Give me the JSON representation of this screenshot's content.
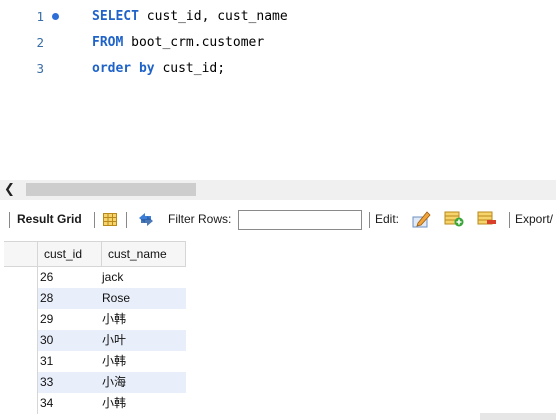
{
  "editor": {
    "lines": [
      {
        "number": "1",
        "executable": true,
        "keyword": "SELECT",
        "rest": " cust_id, cust_name"
      },
      {
        "number": "2",
        "executable": false,
        "keyword": "FROM",
        "rest": " boot_crm.customer"
      },
      {
        "number": "3",
        "executable": false,
        "keyword": "order by",
        "rest": " cust_id;"
      }
    ]
  },
  "toolbar": {
    "result_grid_label": "Result Grid",
    "filter_rows_label": "Filter Rows:",
    "filter_rows_value": "",
    "edit_label": "Edit:",
    "export_label": "Export/"
  },
  "grid": {
    "columns": [
      "cust_id",
      "cust_name"
    ],
    "rows": [
      {
        "cust_id": "26",
        "cust_name": "jack"
      },
      {
        "cust_id": "28",
        "cust_name": "Rose"
      },
      {
        "cust_id": "29",
        "cust_name": "小韩"
      },
      {
        "cust_id": "30",
        "cust_name": "小叶"
      },
      {
        "cust_id": "31",
        "cust_name": "小韩"
      },
      {
        "cust_id": "33",
        "cust_name": "小海"
      },
      {
        "cust_id": "34",
        "cust_name": "小韩"
      }
    ]
  },
  "icons": {
    "grid": "grid-view-icon",
    "refresh": "refresh-arrows-icon",
    "edit": "edit-pencil-icon",
    "add_row": "add-row-icon",
    "delete_row": "delete-row-icon",
    "scroll_left": "chevron-left-icon"
  },
  "colors": {
    "keyword": "#1f63c9",
    "line_number": "#3b6ea5",
    "alt_row": "#e8effa"
  }
}
